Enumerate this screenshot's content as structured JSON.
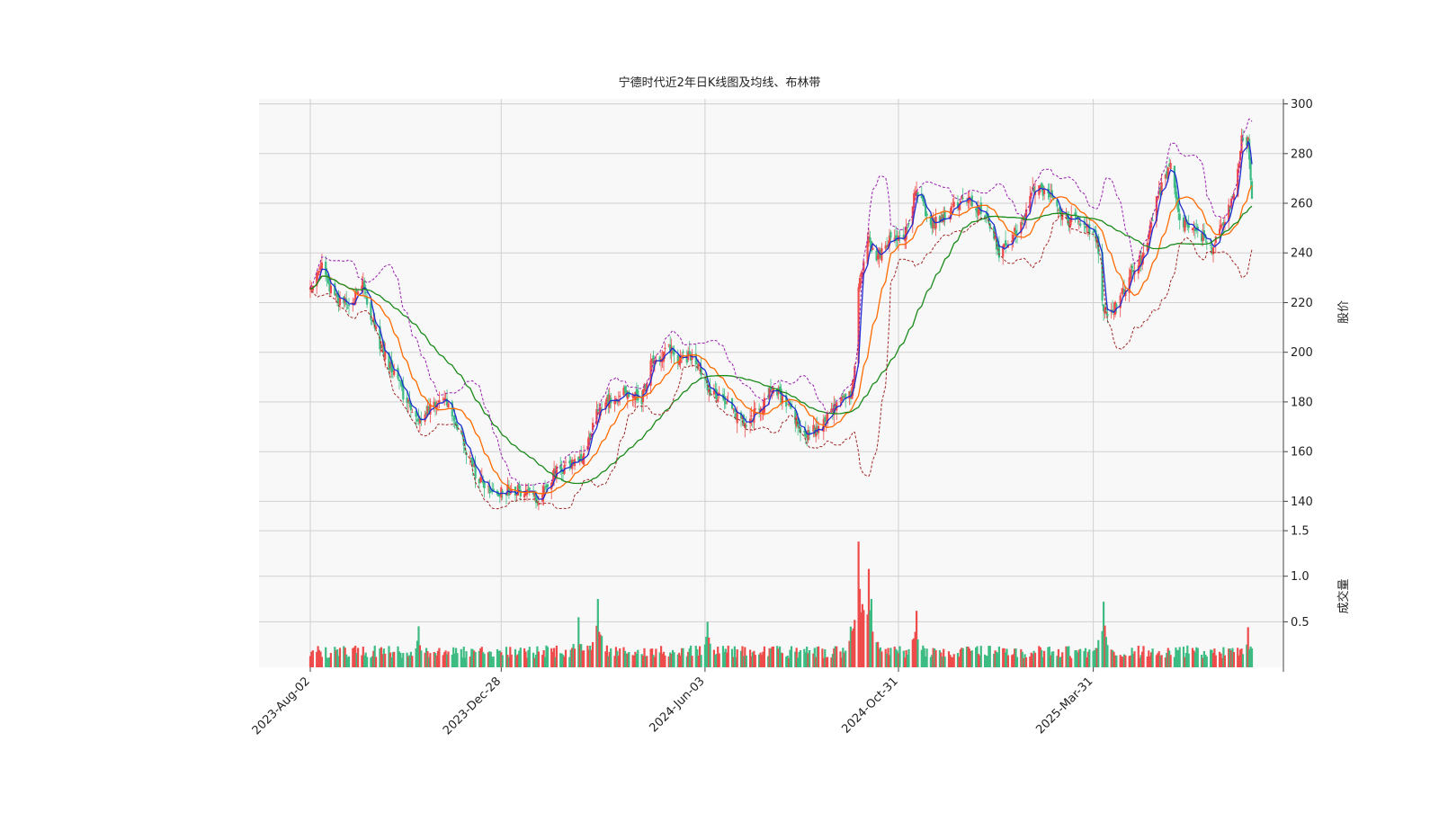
{
  "chart_data": {
    "type": "candlestick",
    "title": "宁德时代近2年日K线图及均线、布林带",
    "price_axis": {
      "label": "股价",
      "ylim": [
        130,
        302
      ],
      "ticks": [
        140,
        160,
        180,
        200,
        220,
        240,
        260,
        280,
        300
      ],
      "position": "right",
      "grid": true
    },
    "volume_axis": {
      "label": "成交量",
      "ylim": [
        0,
        1.55
      ],
      "ticks": [
        0.5,
        1.0,
        1.5
      ],
      "tick_labels": [
        "0.5",
        "1.0",
        "1.5"
      ],
      "position": "right",
      "grid": true
    },
    "x_axis": {
      "start": "2023-08-02",
      "end": "2025-08-01",
      "ticks": [
        {
          "date": "2023-08-02",
          "label": "2023-Aug-02"
        },
        {
          "date": "2023-12-28",
          "label": "2023-Dec-28"
        },
        {
          "date": "2024-06-03",
          "label": "2024-Jun-03"
        },
        {
          "date": "2024-10-31",
          "label": "2024-Oct-31"
        },
        {
          "date": "2025-03-31",
          "label": "2025-Mar-31"
        }
      ],
      "label_rotation": "45"
    },
    "colors": {
      "up": "#ef4b4b",
      "down": "#3cbb82",
      "ma_short": "#1f2ccf",
      "ma_mid": "#ff6a00",
      "ma_long": "#1a8a1a",
      "boll_upper": "#9a1fb0",
      "boll_lower": "#a22626",
      "plot_bg": "#f8f8f8",
      "grid": "#d0d0d0"
    },
    "close_anchors": [
      [
        "2023-08-02",
        225
      ],
      [
        "2023-08-10",
        236
      ],
      [
        "2023-08-20",
        222
      ],
      [
        "2023-08-31",
        219
      ],
      [
        "2023-09-12",
        226
      ],
      [
        "2023-09-25",
        203
      ],
      [
        "2023-10-12",
        184
      ],
      [
        "2023-10-25",
        170
      ],
      [
        "2023-11-05",
        179
      ],
      [
        "2023-11-14",
        182
      ],
      [
        "2023-11-28",
        165
      ],
      [
        "2023-12-08",
        151
      ],
      [
        "2023-12-22",
        142
      ],
      [
        "2024-01-04",
        145
      ],
      [
        "2024-01-18",
        143
      ],
      [
        "2024-01-26",
        140
      ],
      [
        "2024-02-08",
        152
      ],
      [
        "2024-02-20",
        154
      ],
      [
        "2024-03-01",
        157
      ],
      [
        "2024-03-11",
        177
      ],
      [
        "2024-03-22",
        181
      ],
      [
        "2024-04-03",
        184
      ],
      [
        "2024-04-15",
        181
      ],
      [
        "2024-04-22",
        196
      ],
      [
        "2024-05-06",
        201
      ],
      [
        "2024-05-15",
        197
      ],
      [
        "2024-05-25",
        199
      ],
      [
        "2024-06-05",
        185
      ],
      [
        "2024-06-20",
        179
      ],
      [
        "2024-07-03",
        172
      ],
      [
        "2024-07-15",
        177
      ],
      [
        "2024-07-25",
        186
      ],
      [
        "2024-08-06",
        178
      ],
      [
        "2024-08-20",
        166
      ],
      [
        "2024-09-02",
        171
      ],
      [
        "2024-09-12",
        178
      ],
      [
        "2024-09-24",
        183
      ],
      [
        "2024-09-27",
        195
      ],
      [
        "2024-09-30",
        228
      ],
      [
        "2024-10-08",
        245
      ],
      [
        "2024-10-15",
        238
      ],
      [
        "2024-10-24",
        246
      ],
      [
        "2024-11-05",
        247
      ],
      [
        "2024-11-14",
        266
      ],
      [
        "2024-11-25",
        252
      ],
      [
        "2024-12-06",
        254
      ],
      [
        "2024-12-18",
        262
      ],
      [
        "2024-12-30",
        259
      ],
      [
        "2025-01-08",
        255
      ],
      [
        "2025-01-17",
        240
      ],
      [
        "2025-02-04",
        252
      ],
      [
        "2025-02-13",
        267
      ],
      [
        "2025-02-28",
        262
      ],
      [
        "2025-03-10",
        253
      ],
      [
        "2025-03-20",
        254
      ],
      [
        "2025-03-28",
        248
      ],
      [
        "2025-04-03",
        246
      ],
      [
        "2025-04-08",
        215
      ],
      [
        "2025-04-18",
        219
      ],
      [
        "2025-04-30",
        232
      ],
      [
        "2025-05-10",
        240
      ],
      [
        "2025-05-20",
        263
      ],
      [
        "2025-05-30",
        276
      ],
      [
        "2025-06-06",
        253
      ],
      [
        "2025-06-16",
        250
      ],
      [
        "2025-06-25",
        246
      ],
      [
        "2025-07-01",
        242
      ],
      [
        "2025-07-08",
        251
      ],
      [
        "2025-07-18",
        262
      ],
      [
        "2025-07-24",
        286
      ],
      [
        "2025-07-29",
        285
      ],
      [
        "2025-08-01",
        264
      ]
    ],
    "volume_spikes": [
      [
        "2023-10-25",
        0.45
      ],
      [
        "2024-02-26",
        0.55
      ],
      [
        "2024-03-12",
        0.75
      ],
      [
        "2024-06-05",
        0.5
      ],
      [
        "2024-09-30",
        1.38
      ],
      [
        "2024-10-08",
        1.08
      ],
      [
        "2024-10-10",
        0.75
      ],
      [
        "2024-11-14",
        0.62
      ],
      [
        "2025-04-08",
        0.72
      ],
      [
        "2025-07-29",
        0.44
      ]
    ],
    "series": [
      {
        "key": "ma_short",
        "kind": "line"
      },
      {
        "key": "ma_mid",
        "kind": "line"
      },
      {
        "key": "ma_long",
        "kind": "line"
      },
      {
        "key": "boll_upper",
        "kind": "dashed"
      },
      {
        "key": "boll_lower",
        "kind": "dashed"
      }
    ]
  }
}
